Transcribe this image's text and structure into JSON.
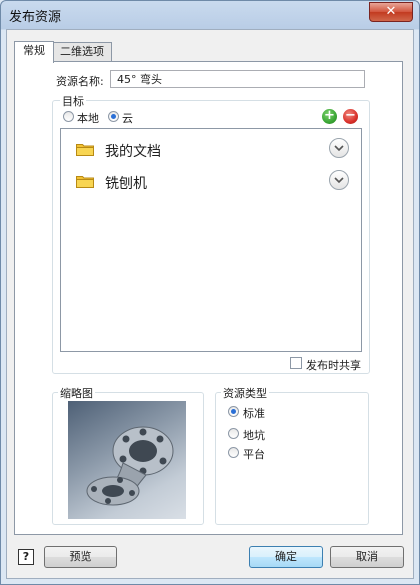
{
  "window": {
    "title": "发布资源",
    "close_glyph": "✕"
  },
  "tabs": [
    {
      "label": "常规",
      "active": true
    },
    {
      "label": "二维选项",
      "active": false
    }
  ],
  "resource_name": {
    "label": "资源名称:",
    "value": "45° 弯头"
  },
  "target": {
    "title": "目标",
    "options": [
      {
        "label": "本地",
        "checked": false
      },
      {
        "label": "云",
        "checked": true
      }
    ],
    "add_icon": "add-icon",
    "remove_icon": "remove-icon",
    "folders": [
      {
        "label": "我的文档",
        "icon": "folder-icon"
      },
      {
        "label": "铣刨机",
        "icon": "folder-icon"
      }
    ],
    "share_checkbox": {
      "label": "发布时共享",
      "checked": false
    }
  },
  "thumbnail": {
    "title": "缩略图"
  },
  "resource_type": {
    "title": "资源类型",
    "options": [
      {
        "label": "标准",
        "checked": true
      },
      {
        "label": "地坑",
        "checked": false
      },
      {
        "label": "平台",
        "checked": false
      }
    ]
  },
  "footer": {
    "help_glyph": "?",
    "preview_label": "预览",
    "ok_label": "确定",
    "cancel_label": "取消"
  },
  "colors": {
    "folder": "#f3c233",
    "add": "#3aa635",
    "remove": "#d9302a",
    "radio_dot": "#2a6fd6"
  }
}
